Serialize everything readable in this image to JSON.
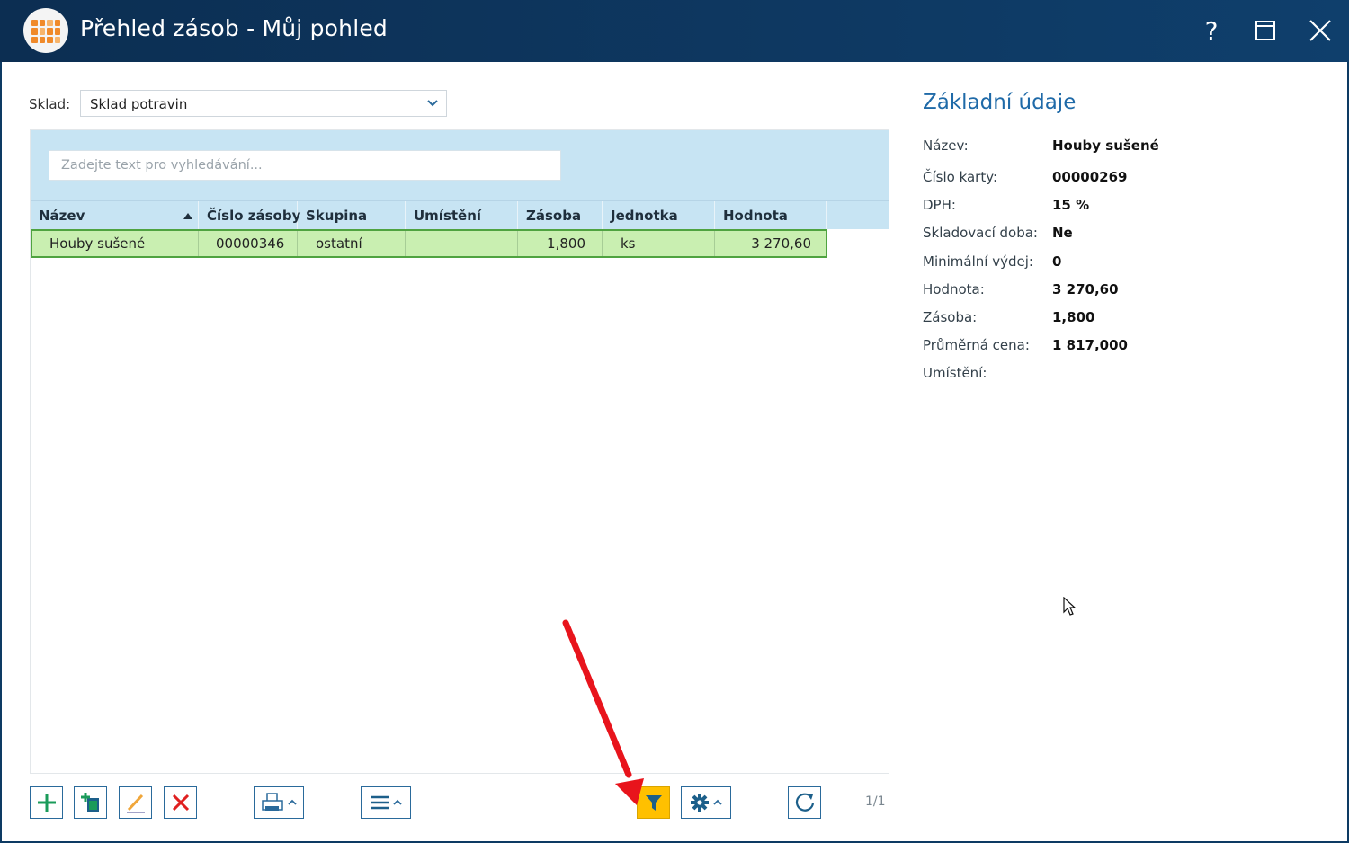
{
  "window": {
    "title": "Přehled zásob - Můj pohled",
    "help_label": "?"
  },
  "filter_bar": {
    "sklad_label": "Sklad:",
    "sklad_value": "Sklad potravin"
  },
  "search": {
    "placeholder": "Zadejte text pro vyhledávání..."
  },
  "table": {
    "columns": [
      "Název",
      "Číslo zásoby",
      "Skupina",
      "Umístění",
      "Zásoba",
      "Jednotka",
      "Hodnota"
    ],
    "rows": [
      [
        "Houby sušené",
        "00000346",
        "ostatní",
        "",
        "1,800",
        "ks",
        "3 270,60"
      ]
    ]
  },
  "details": {
    "title": "Základní údaje",
    "fields": [
      {
        "label": "Název:",
        "value": "Houby sušené"
      },
      {
        "label": "Číslo karty:",
        "value": "00000269"
      },
      {
        "label": "DPH:",
        "value": "15 %"
      },
      {
        "label": "Skladovací doba:",
        "value": "Ne"
      },
      {
        "label": "Minimální výdej:",
        "value": "0"
      },
      {
        "label": "Hodnota:",
        "value": "3 270,60"
      },
      {
        "label": "Zásoba:",
        "value": "1,800"
      },
      {
        "label": "Průměrná cena:",
        "value": "1 817,000"
      },
      {
        "label": "Umístění:",
        "value": ""
      }
    ]
  },
  "pager": {
    "text": "1/1"
  },
  "toolbar": {
    "icons": [
      "add-icon",
      "copy-add-icon",
      "edit-icon",
      "delete-icon",
      "print-icon",
      "menu-icon",
      "filter-icon",
      "gear-icon",
      "refresh-icon"
    ],
    "filter_active_color": "#ffc000"
  },
  "colors": {
    "titlebar": "#0c2e52",
    "accent": "#1f6aa8",
    "selected_row": "#c9efb1",
    "header_band": "#c7e4f3",
    "annotation_arrow": "#e8141c"
  }
}
